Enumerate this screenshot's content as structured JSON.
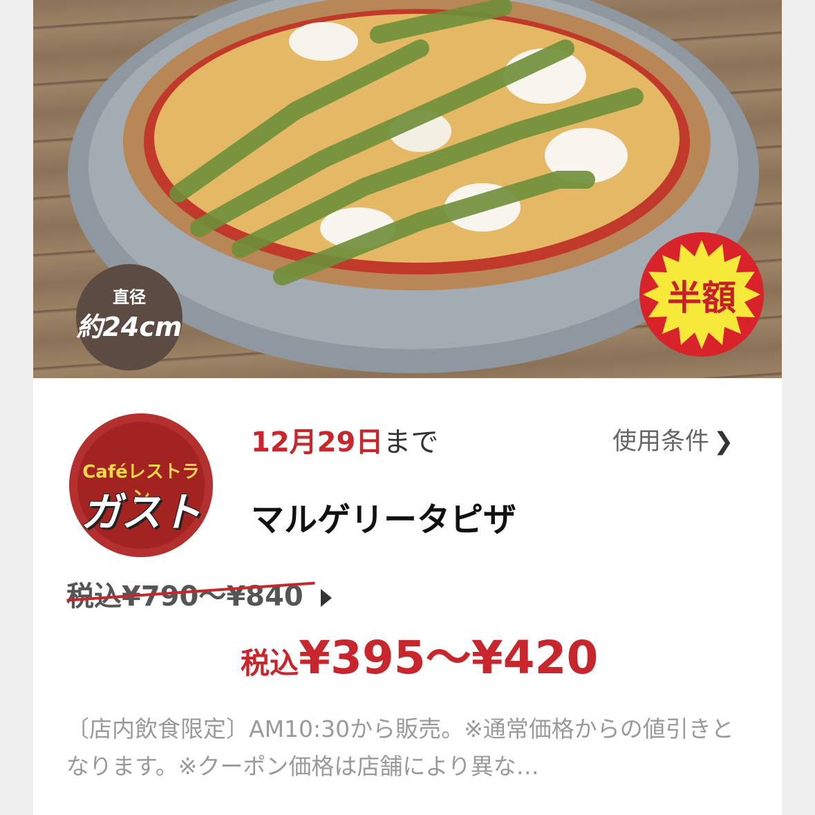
{
  "photo": {
    "size_badge": {
      "line1": "直径",
      "line2": "約24cm"
    },
    "half_badge": "半額"
  },
  "brand_logo": {
    "line1": "Caféレストラン",
    "line2": "ガスト"
  },
  "coupon": {
    "date_value": "12月29日",
    "date_suffix": "まで",
    "terms_label": "使用条件",
    "name": "マルゲリータピザ",
    "old_price": "税込¥790〜¥840",
    "new_price_prefix": "税込",
    "new_price": "¥395〜¥420",
    "note": "〔店内飲食限定〕AM10:30から販売。※通常価格からの値引きとなります。※クーポン価格は店舗により異な…"
  },
  "colors": {
    "accent_red": "#c8262d",
    "badge_yellow": "#f6e93a",
    "badge_brown": "#5b4b42"
  }
}
